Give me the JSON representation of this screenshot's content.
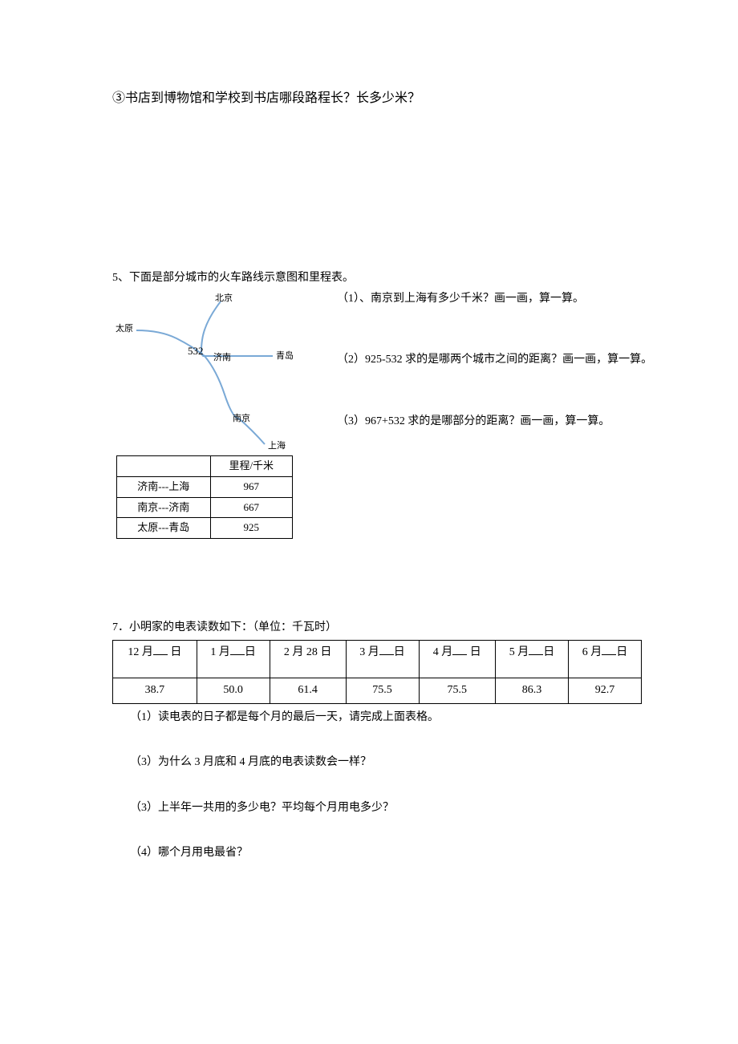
{
  "q3": {
    "text": "③书店到博物馆和学校到书店哪段路程长？长多少米？"
  },
  "q5": {
    "intro": "5、下面是部分城市的火车路线示意图和里程表。",
    "map": {
      "cities": {
        "beijing": "北京",
        "taiyuan": "太原",
        "jinan": "济南",
        "qingdao": "青岛",
        "nanjing": "南京",
        "shanghai": "上海"
      },
      "tj_ji_label": "532"
    },
    "sub1": "（1）、南京到上海有多少千米？画一画，算一算。",
    "sub2": "（2）925-532 求的是哪两个城市之间的距离？画一画，算一算。",
    "sub3": "（3）967+532 求的是哪部分的距离？画一画，算一算。",
    "table": {
      "header_blank": "",
      "header_km": "里程/千米",
      "rows": [
        {
          "route": "济南---上海",
          "km": "967"
        },
        {
          "route": "南京---济南",
          "km": "667"
        },
        {
          "route": "太原---青岛",
          "km": "925"
        }
      ]
    }
  },
  "q7": {
    "intro": "7．小明家的电表读数如下：（单位：千瓦时）",
    "headers": [
      {
        "prefix": "12 月",
        "suffix": "日"
      },
      {
        "prefix": "1 月",
        "suffix": "日"
      },
      {
        "full": "2 月 28 日"
      },
      {
        "prefix": "3 月",
        "suffix": "日"
      },
      {
        "prefix": "4 月",
        "suffix": "日"
      },
      {
        "prefix": "5 月",
        "suffix": "日"
      },
      {
        "prefix": "6 月",
        "suffix": "日"
      }
    ],
    "values": [
      "38.7",
      "50.0",
      "61.4",
      "75.5",
      "75.5",
      "86.3",
      "92.7"
    ],
    "sub1": "（1）读电表的日子都是每个月的最后一天，请完成上面表格。",
    "sub2": "（3）为什么 3 月底和 4 月底的电表读数会一样？",
    "sub3": "（3）上半年一共用的多少电？平均每个月用电多少？",
    "sub4": "（4）哪个月用电最省？"
  }
}
